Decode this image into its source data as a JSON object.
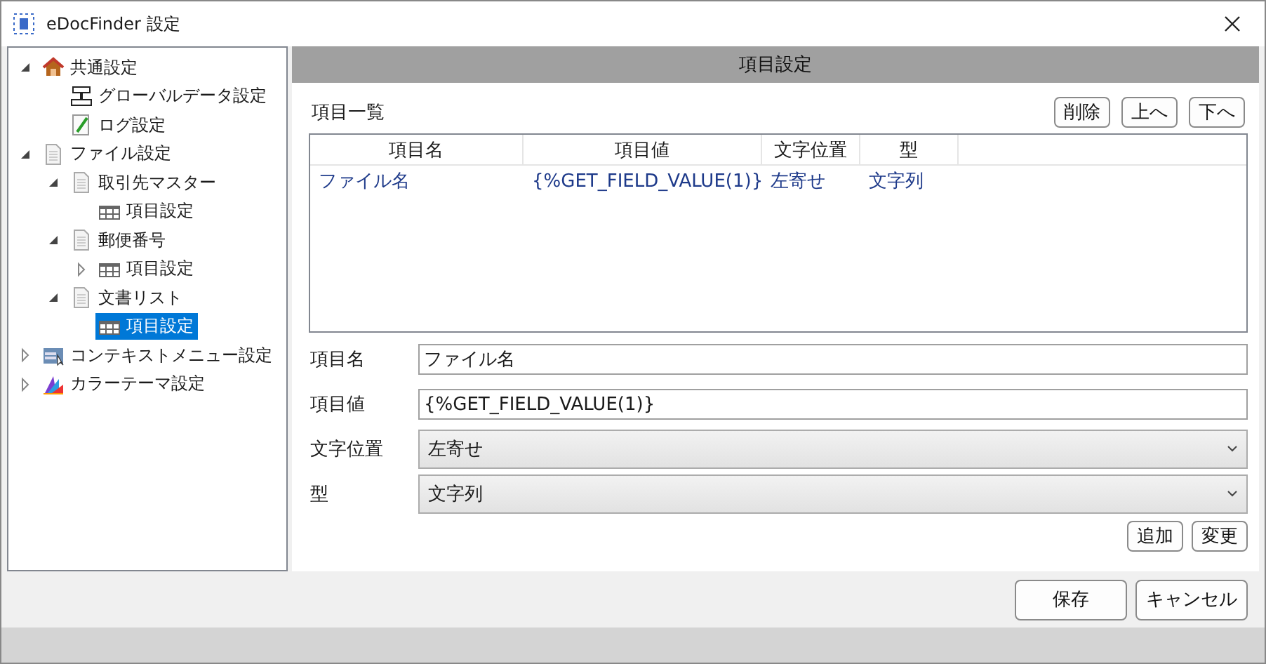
{
  "window": {
    "title": "eDocFinder 設定"
  },
  "tree": [
    {
      "label": "共通設定",
      "kind": "house",
      "expanded": true,
      "selected": false,
      "children": [
        {
          "label": "グローバルデータ設定",
          "kind": "server",
          "selected": false
        },
        {
          "label": "ログ設定",
          "kind": "log",
          "selected": false
        }
      ]
    },
    {
      "label": "ファイル設定",
      "kind": "doc",
      "expanded": true,
      "selected": false,
      "children": [
        {
          "label": "取引先マスター",
          "kind": "doc",
          "expanded": true,
          "selected": false,
          "children": [
            {
              "label": "項目設定",
              "kind": "table",
              "selected": false
            }
          ]
        },
        {
          "label": "郵便番号",
          "kind": "doc",
          "expanded": true,
          "selected": false,
          "children": [
            {
              "label": "項目設定",
              "kind": "table",
              "expanded": false,
              "selected": false
            }
          ]
        },
        {
          "label": "文書リスト",
          "kind": "doc",
          "expanded": true,
          "selected": false,
          "children": [
            {
              "label": "項目設定",
              "kind": "table",
              "selected": true
            }
          ]
        }
      ]
    },
    {
      "label": "コンテキストメニュー設定",
      "kind": "menu",
      "expanded": false,
      "selected": false
    },
    {
      "label": "カラーテーマ設定",
      "kind": "palette",
      "expanded": false,
      "selected": false
    }
  ],
  "panel": {
    "title": "項目設定",
    "list_label": "項目一覧",
    "list_buttons": [
      "削除",
      "上へ",
      "下へ"
    ],
    "table": {
      "columns": [
        "項目名",
        "項目値",
        "文字位置",
        "型"
      ],
      "rows": [
        [
          "ファイル名",
          "{%GET_FIELD_VALUE(1)}",
          "左寄せ",
          "文字列"
        ]
      ]
    },
    "fields": [
      {
        "label": "項目名",
        "kind": "text",
        "value": "ファイル名"
      },
      {
        "label": "項目値",
        "kind": "text",
        "value": "{%GET_FIELD_VALUE(1)}"
      },
      {
        "label": "文字位置",
        "kind": "select",
        "value": "左寄せ"
      },
      {
        "label": "型",
        "kind": "select",
        "value": "文字列"
      }
    ],
    "form_buttons": [
      "追加",
      "変更"
    ]
  },
  "buttons": [
    "保存",
    "キャンセル"
  ]
}
